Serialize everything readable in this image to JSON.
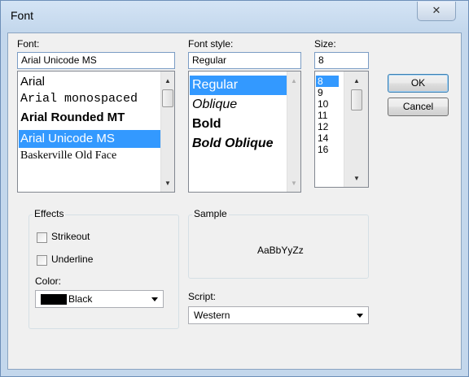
{
  "window": {
    "title": "Font",
    "close_glyph": "✕"
  },
  "font": {
    "label": "Font:",
    "value": "Arial Unicode MS",
    "items": [
      {
        "label": "Arial"
      },
      {
        "label": "Arial monospaced"
      },
      {
        "label": "Arial Rounded MT"
      },
      {
        "label": "Arial Unicode MS",
        "selected": true
      },
      {
        "label": "Baskerville Old Face"
      }
    ]
  },
  "style": {
    "label": "Font style:",
    "value": "Regular",
    "items": [
      {
        "label": "Regular",
        "selected": true
      },
      {
        "label": "Oblique"
      },
      {
        "label": "Bold"
      },
      {
        "label": "Bold Oblique"
      }
    ]
  },
  "size": {
    "label": "Size:",
    "value": "8",
    "items": [
      {
        "label": "8",
        "selected": true
      },
      {
        "label": "9"
      },
      {
        "label": "10"
      },
      {
        "label": "11"
      },
      {
        "label": "12"
      },
      {
        "label": "14"
      },
      {
        "label": "16"
      }
    ]
  },
  "buttons": {
    "ok": "OK",
    "cancel": "Cancel"
  },
  "effects": {
    "group_label": "Effects",
    "strikeout": {
      "label": "Strikeout",
      "checked": false
    },
    "underline": {
      "label": "Underline",
      "checked": false
    },
    "color_label": "Color:",
    "color": {
      "name": "Black",
      "swatch": "#000000"
    }
  },
  "sample": {
    "group_label": "Sample",
    "text": "AaBbYyZz"
  },
  "script": {
    "label": "Script:",
    "value": "Western"
  },
  "icons": {
    "scroll_up": "▲",
    "scroll_down": "▼"
  },
  "colors": {
    "selection": "#3399ff",
    "window_frame": "#c3d7ec",
    "dialog_bg": "#f0f0f0"
  }
}
